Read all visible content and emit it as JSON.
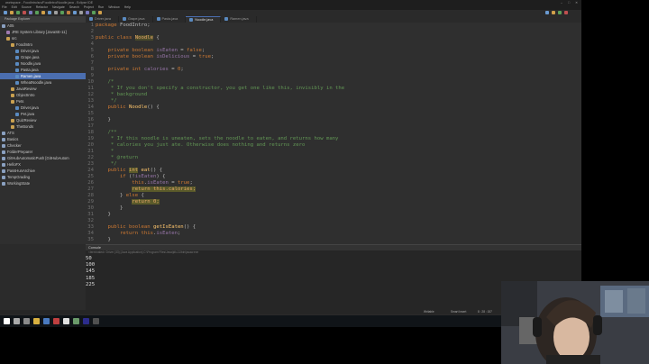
{
  "window": {
    "title": "workspace - FoodIntro/src/FoodIntro/Noodle.java - Eclipse IDE",
    "controls": [
      "–",
      "□",
      "✕"
    ]
  },
  "menu": [
    "File",
    "Edit",
    "Source",
    "Refactor",
    "Navigate",
    "Search",
    "Project",
    "Run",
    "Window",
    "Help"
  ],
  "package_explorer": {
    "title": "Package Explorer",
    "items": [
      {
        "label": "A05",
        "indent": 0,
        "icon": "project-icon"
      },
      {
        "label": "JRE System Library [JavaSE-11]",
        "indent": 1,
        "icon": "library-icon"
      },
      {
        "label": "src",
        "indent": 1,
        "icon": "folder-icon"
      },
      {
        "label": "FoodIntro",
        "indent": 2,
        "icon": "package-icon"
      },
      {
        "label": "Driver.java",
        "indent": 3,
        "icon": "java-file-icon"
      },
      {
        "label": "Grape.java",
        "indent": 3,
        "icon": "java-file-icon"
      },
      {
        "label": "Noodle.java",
        "indent": 3,
        "icon": "java-file-icon"
      },
      {
        "label": "Pasta.java",
        "indent": 3,
        "icon": "java-file-icon"
      },
      {
        "label": "Ramen.java",
        "indent": 3,
        "icon": "java-file-icon",
        "selected": true
      },
      {
        "label": "WheatNoodle.java",
        "indent": 3,
        "icon": "java-file-icon"
      },
      {
        "label": "JavaReview",
        "indent": 2,
        "icon": "package-icon"
      },
      {
        "label": "ObjectIntro",
        "indent": 2,
        "icon": "package-icon"
      },
      {
        "label": "Pets",
        "indent": 2,
        "icon": "package-icon"
      },
      {
        "label": "Driver.java",
        "indent": 3,
        "icon": "java-file-icon"
      },
      {
        "label": "Pet.java",
        "indent": 3,
        "icon": "java-file-icon"
      },
      {
        "label": "QuizReview",
        "indent": 2,
        "icon": "package-icon"
      },
      {
        "label": "TheBonds",
        "indent": 2,
        "icon": "package-icon"
      },
      {
        "label": "ATS",
        "indent": 0,
        "icon": "project-icon"
      },
      {
        "label": "Basics",
        "indent": 0,
        "icon": "project-icon"
      },
      {
        "label": "Checker",
        "indent": 0,
        "icon": "project-icon"
      },
      {
        "label": "FolderPreparer",
        "indent": 0,
        "icon": "project-icon"
      },
      {
        "label": "GitHubAutomaticPush [GitHubAutom",
        "indent": 0,
        "icon": "project-icon"
      },
      {
        "label": "HelloFX",
        "indent": 0,
        "icon": "project-icon"
      },
      {
        "label": "PassHunArchive",
        "indent": 0,
        "icon": "project-icon"
      },
      {
        "label": "TempGrading",
        "indent": 0,
        "icon": "project-icon"
      },
      {
        "label": "WorkingState",
        "indent": 0,
        "icon": "project-icon"
      }
    ]
  },
  "tabs": [
    {
      "label": "Driver.java",
      "active": false
    },
    {
      "label": "Grape.java",
      "active": false
    },
    {
      "label": "Pasta.java",
      "active": false
    },
    {
      "label": "Noodle.java",
      "active": true
    },
    {
      "label": "Ramen.java",
      "active": false
    }
  ],
  "editor": {
    "lines": [
      {
        "n": "1",
        "segs": [
          {
            "t": "package ",
            "c": "k"
          },
          {
            "t": "FoodIntro;"
          }
        ]
      },
      {
        "n": "2",
        "segs": []
      },
      {
        "n": "3",
        "segs": [
          {
            "t": "public class ",
            "c": "k"
          },
          {
            "t": "Noodle",
            "c": "hl2"
          },
          {
            "t": " {"
          }
        ]
      },
      {
        "n": "4",
        "segs": []
      },
      {
        "n": "5",
        "segs": [
          {
            "t": "    private boolean ",
            "c": "k"
          },
          {
            "t": "isEaten",
            "c": "f"
          },
          {
            "t": " = "
          },
          {
            "t": "false",
            "c": "k"
          },
          {
            "t": ";"
          }
        ]
      },
      {
        "n": "6",
        "segs": [
          {
            "t": "    private boolean ",
            "c": "k"
          },
          {
            "t": "isDelicious",
            "c": "f"
          },
          {
            "t": " = "
          },
          {
            "t": "true",
            "c": "k"
          },
          {
            "t": ";"
          }
        ]
      },
      {
        "n": "7",
        "segs": []
      },
      {
        "n": "8",
        "segs": [
          {
            "t": "    private int ",
            "c": "k"
          },
          {
            "t": "calories",
            "c": "f"
          },
          {
            "t": " = "
          },
          {
            "t": "0",
            "c": "k"
          },
          {
            "t": ";"
          }
        ]
      },
      {
        "n": "9",
        "segs": []
      },
      {
        "n": "10",
        "segs": [
          {
            "t": "    /*",
            "c": "c"
          }
        ]
      },
      {
        "n": "11",
        "segs": [
          {
            "t": "     * If you don't specify a constructor, you get one like this, invisibly in the",
            "c": "c"
          }
        ]
      },
      {
        "n": "12",
        "segs": [
          {
            "t": "     * background",
            "c": "c"
          }
        ]
      },
      {
        "n": "13",
        "segs": [
          {
            "t": "     */",
            "c": "c"
          }
        ]
      },
      {
        "n": "14",
        "segs": [
          {
            "t": "    public ",
            "c": "k"
          },
          {
            "t": "Noodle",
            "c": "s"
          },
          {
            "t": "() {"
          }
        ]
      },
      {
        "n": "15",
        "segs": []
      },
      {
        "n": "16",
        "segs": [
          {
            "t": "    }"
          }
        ]
      },
      {
        "n": "17",
        "segs": []
      },
      {
        "n": "18",
        "segs": [
          {
            "t": "    /**",
            "c": "c"
          }
        ]
      },
      {
        "n": "19",
        "segs": [
          {
            "t": "     * If this noodle is uneaten, sets the noodle to eaten, and returns how many",
            "c": "c"
          }
        ]
      },
      {
        "n": "20",
        "segs": [
          {
            "t": "     * calories you just ate. Otherwise does nothing and returns zero",
            "c": "c"
          }
        ]
      },
      {
        "n": "21",
        "segs": [
          {
            "t": "     *",
            "c": "c"
          }
        ]
      },
      {
        "n": "22",
        "segs": [
          {
            "t": "     * @return",
            "c": "c"
          }
        ]
      },
      {
        "n": "23",
        "segs": [
          {
            "t": "     */",
            "c": "c"
          }
        ]
      },
      {
        "n": "24",
        "segs": [
          {
            "t": "    public ",
            "c": "k"
          },
          {
            "t": "int",
            "c": "hl"
          },
          {
            "t": " "
          },
          {
            "t": "eat",
            "c": "s"
          },
          {
            "t": "() {"
          }
        ]
      },
      {
        "n": "25",
        "segs": [
          {
            "t": "        if ",
            "c": "k"
          },
          {
            "t": "(!"
          },
          {
            "t": "isEaten",
            "c": "f"
          },
          {
            "t": ") {"
          }
        ]
      },
      {
        "n": "26",
        "segs": [
          {
            "t": "            this",
            "c": "k"
          },
          {
            "t": "."
          },
          {
            "t": "isEaten",
            "c": "f"
          },
          {
            "t": " = "
          },
          {
            "t": "true",
            "c": "k"
          },
          {
            "t": ";"
          }
        ]
      },
      {
        "n": "27",
        "segs": [
          {
            "t": "            "
          },
          {
            "t": "return this.calories;",
            "c": "hl"
          }
        ]
      },
      {
        "n": "28",
        "segs": [
          {
            "t": "        } "
          },
          {
            "t": "else",
            "c": "k"
          },
          {
            "t": " {"
          }
        ]
      },
      {
        "n": "29",
        "segs": [
          {
            "t": "            "
          },
          {
            "t": "return 0;",
            "c": "hl"
          }
        ]
      },
      {
        "n": "30",
        "segs": [
          {
            "t": "        }"
          }
        ]
      },
      {
        "n": "31",
        "segs": [
          {
            "t": "    }"
          }
        ]
      },
      {
        "n": "32",
        "segs": []
      },
      {
        "n": "33",
        "segs": [
          {
            "t": "    public boolean ",
            "c": "k"
          },
          {
            "t": "getIsEaten",
            "c": "s"
          },
          {
            "t": "() {"
          }
        ]
      },
      {
        "n": "34",
        "segs": [
          {
            "t": "        return ",
            "c": "k"
          },
          {
            "t": "this",
            "c": "k"
          },
          {
            "t": "."
          },
          {
            "t": "isEaten",
            "c": "f"
          },
          {
            "t": ";"
          }
        ]
      },
      {
        "n": "35",
        "segs": [
          {
            "t": "    }"
          }
        ]
      }
    ]
  },
  "console": {
    "title": "Console",
    "path": "<terminated> Driver (33) [Java Application] C:\\Program Files\\Java\\jdk-11\\bin\\javaw.exe",
    "output": [
      "50",
      "100",
      "145",
      "185",
      "225"
    ]
  },
  "status": {
    "writable": "Writable",
    "insert": "Smart Insert",
    "position": "8 : 28 : 157"
  },
  "colors": {
    "accent": "#4b6eaf",
    "keyword": "#cc7832",
    "field": "#9876aa",
    "comment": "#629755",
    "method": "#ffc66d"
  },
  "taskbar": {
    "icons": [
      "windows-start-icon",
      "search-icon",
      "task-view-icon",
      "file-explorer-icon",
      "store-icon",
      "app-icon",
      "chrome-icon",
      "app-icon",
      "eclipse-icon",
      "obs-icon"
    ]
  }
}
